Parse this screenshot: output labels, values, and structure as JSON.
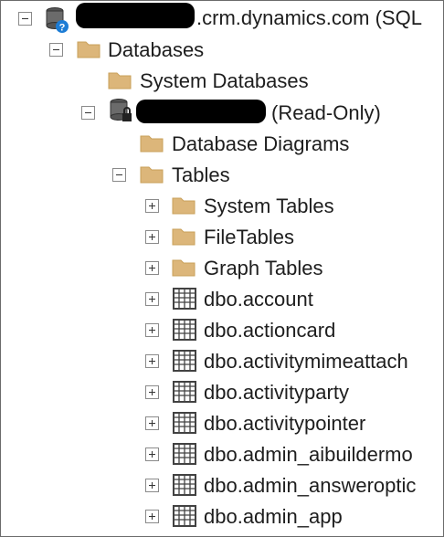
{
  "server": {
    "label_visible": ".crm.dynamics.com (SQL"
  },
  "databases": {
    "label": "Databases"
  },
  "system_databases": {
    "label": "System Databases"
  },
  "database": {
    "label_visible": "(Read-Only)"
  },
  "folders": {
    "diagrams": "Database Diagrams",
    "tables": "Tables",
    "system_tables": "System Tables",
    "file_tables": "FileTables",
    "graph_tables": "Graph Tables"
  },
  "tables": [
    "dbo.account",
    "dbo.actioncard",
    "dbo.activitymimeattach",
    "dbo.activityparty",
    "dbo.activitypointer",
    "dbo.admin_aibuildermo",
    "dbo.admin_answeroptic",
    "dbo.admin_app"
  ],
  "colors": {
    "folder": "#dcb67a",
    "folder_dark": "#c9a05a",
    "grid": "#424242",
    "badge": "#1c7cd5"
  },
  "icons": [
    "database-icon",
    "folder-icon",
    "table-icon"
  ]
}
